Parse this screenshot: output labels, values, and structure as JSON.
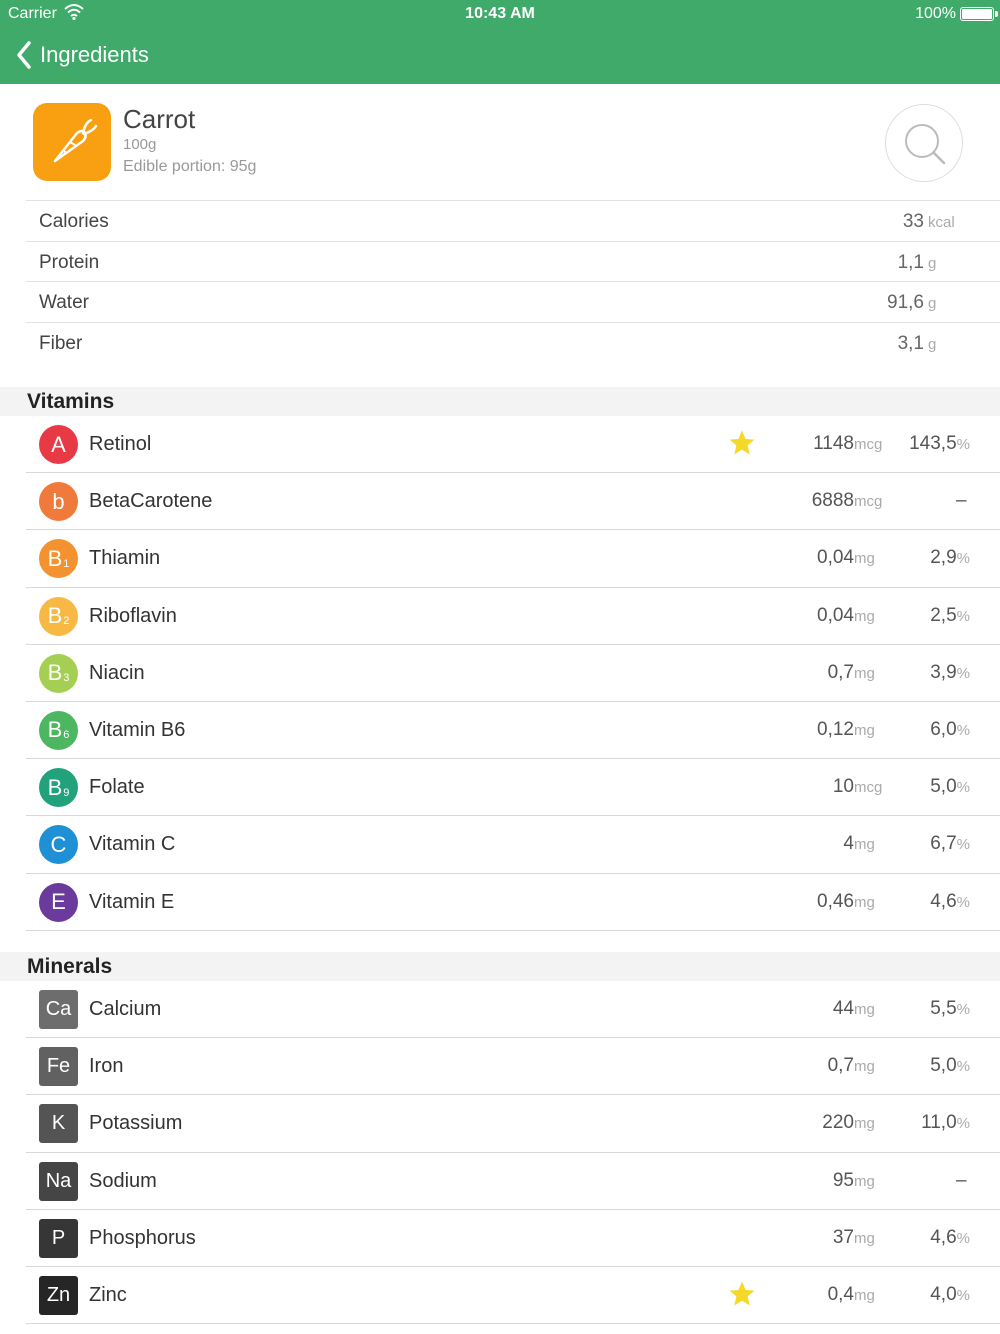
{
  "status_bar": {
    "carrier": "Carrier",
    "time": "10:43 AM",
    "battery": "100%"
  },
  "nav": {
    "back_label": "Ingredients",
    "color": "#3faa6a"
  },
  "food": {
    "name": "Carrot",
    "weight": "100g",
    "edible": "Edible portion: 95g",
    "icon": "carrot-icon",
    "icon_color": "#f8a012"
  },
  "basic": [
    {
      "name": "Calories",
      "value": "33",
      "unit": "kcal"
    },
    {
      "name": "Protein",
      "value": "1,1",
      "unit": "g"
    },
    {
      "name": "Water",
      "value": "91,6",
      "unit": "g"
    },
    {
      "name": "Fiber",
      "value": "3,1",
      "unit": "g"
    }
  ],
  "vitamins": {
    "title": "Vitamins",
    "items": [
      {
        "badge": "A",
        "sub": "",
        "color": "#e83a45",
        "name": "Retinol",
        "star": true,
        "value": "1148",
        "unit": "mcg",
        "pct": "143,5",
        "pct_sym": "%"
      },
      {
        "badge": "b",
        "sub": "",
        "color": "#f07a3c",
        "name": "BetaCarotene",
        "star": false,
        "value": "6888",
        "unit": "mcg",
        "pct": "",
        "pct_sym": "",
        "dash": "–"
      },
      {
        "badge": "B",
        "sub": "1",
        "color": "#f3922f",
        "name": "Thiamin",
        "star": false,
        "value": "0,04",
        "unit": "mg",
        "pct": "2,9",
        "pct_sym": "%"
      },
      {
        "badge": "B",
        "sub": "2",
        "color": "#f7b944",
        "name": "Riboflavin",
        "star": false,
        "value": "0,04",
        "unit": "mg",
        "pct": "2,5",
        "pct_sym": "%"
      },
      {
        "badge": "B",
        "sub": "3",
        "color": "#a4cf52",
        "name": "Niacin",
        "star": false,
        "value": "0,7",
        "unit": "mg",
        "pct": "3,9",
        "pct_sym": "%"
      },
      {
        "badge": "B",
        "sub": "6",
        "color": "#4cb660",
        "name": "Vitamin B6",
        "star": false,
        "value": "0,12",
        "unit": "mg",
        "pct": "6,0",
        "pct_sym": "%"
      },
      {
        "badge": "B",
        "sub": "9",
        "color": "#21a27a",
        "name": "Folate",
        "star": false,
        "value": "10",
        "unit": "mcg",
        "pct": "5,0",
        "pct_sym": "%"
      },
      {
        "badge": "C",
        "sub": "",
        "color": "#1f8fd6",
        "name": "Vitamin C",
        "star": false,
        "value": "4",
        "unit": "mg",
        "pct": "6,7",
        "pct_sym": "%"
      },
      {
        "badge": "E",
        "sub": "",
        "color": "#6a3a9c",
        "name": "Vitamin E",
        "star": false,
        "value": "0,46",
        "unit": "mg",
        "pct": "4,6",
        "pct_sym": "%"
      }
    ]
  },
  "minerals": {
    "title": "Minerals",
    "items": [
      {
        "badge": "Ca",
        "color": "#6d6d6d",
        "name": "Calcium",
        "star": false,
        "value": "44",
        "unit": "mg",
        "pct": "5,5",
        "pct_sym": "%"
      },
      {
        "badge": "Fe",
        "color": "#616161",
        "name": "Iron",
        "star": false,
        "value": "0,7",
        "unit": "mg",
        "pct": "5,0",
        "pct_sym": "%"
      },
      {
        "badge": "K",
        "color": "#545454",
        "name": "Potassium",
        "star": false,
        "value": "220",
        "unit": "mg",
        "pct": "11,0",
        "pct_sym": "%"
      },
      {
        "badge": "Na",
        "color": "#454545",
        "name": "Sodium",
        "star": false,
        "value": "95",
        "unit": "mg",
        "pct": "",
        "pct_sym": "",
        "dash": "–"
      },
      {
        "badge": "P",
        "color": "#363636",
        "name": "Phosphorus",
        "star": false,
        "value": "37",
        "unit": "mg",
        "pct": "4,6",
        "pct_sym": "%"
      },
      {
        "badge": "Zn",
        "color": "#262626",
        "name": "Zinc",
        "star": true,
        "value": "0,4",
        "unit": "mg",
        "pct": "4,0",
        "pct_sym": "%"
      }
    ]
  },
  "star_color": "#f5d82a"
}
